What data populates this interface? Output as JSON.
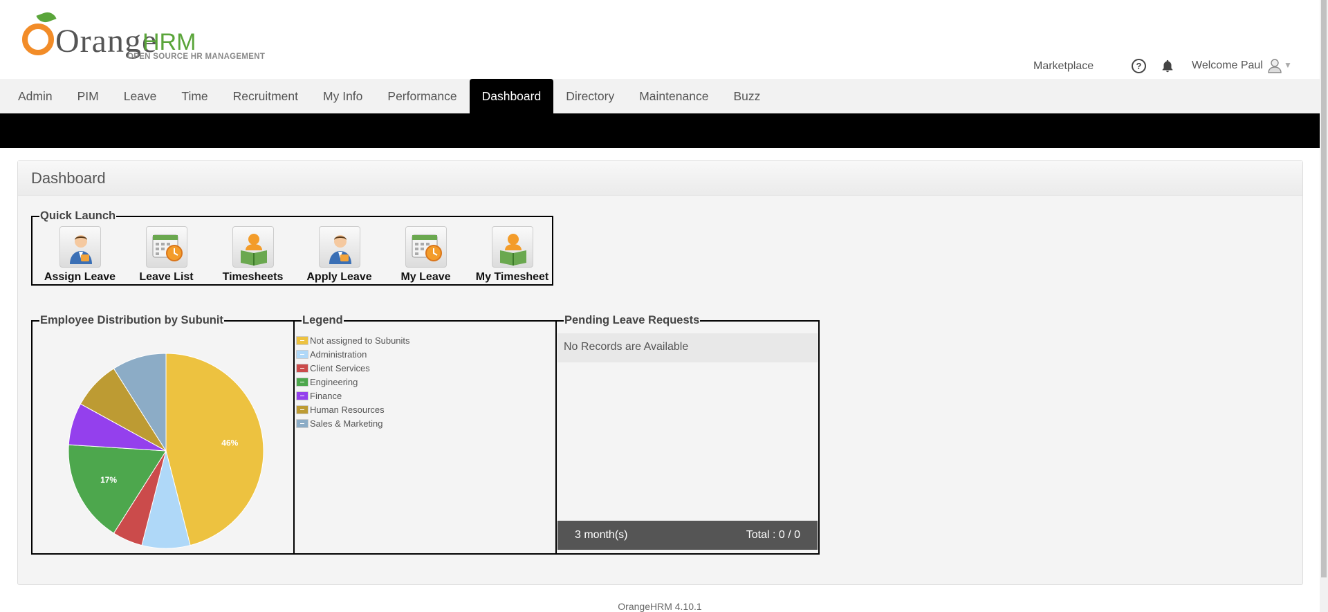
{
  "header": {
    "logo_text_a": "Orange",
    "logo_text_b": "HRM",
    "logo_tagline": "OPEN SOURCE HR MANAGEMENT",
    "marketplace": "Marketplace",
    "help_glyph": "?",
    "welcome": "Welcome Paul",
    "caret": "▼"
  },
  "nav": {
    "items": [
      "Admin",
      "PIM",
      "Leave",
      "Time",
      "Recruitment",
      "My Info",
      "Performance",
      "Dashboard",
      "Directory",
      "Maintenance",
      "Buzz"
    ],
    "active": "Dashboard"
  },
  "dashboard": {
    "title": "Dashboard",
    "quick_launch": {
      "title": "Quick Launch",
      "items": [
        {
          "label": "Assign Leave",
          "icon": "person-leave-icon"
        },
        {
          "label": "Leave List",
          "icon": "calendar-clock-icon"
        },
        {
          "label": "Timesheets",
          "icon": "person-book-icon"
        },
        {
          "label": "Apply Leave",
          "icon": "person-leave-icon"
        },
        {
          "label": "My Leave",
          "icon": "calendar-clock-icon"
        },
        {
          "label": "My Timesheet",
          "icon": "person-book-icon"
        }
      ]
    },
    "distribution": {
      "title": "Employee Distribution by Subunit"
    },
    "legend": {
      "title": "Legend",
      "items": [
        {
          "label": "Not assigned to Subunits",
          "color": "#edc240"
        },
        {
          "label": "Administration",
          "color": "#afd8f8"
        },
        {
          "label": "Client Services",
          "color": "#cb4b4b"
        },
        {
          "label": "Engineering",
          "color": "#4da74d"
        },
        {
          "label": "Finance",
          "color": "#9440ed"
        },
        {
          "label": "Human Resources",
          "color": "#bd9b33"
        },
        {
          "label": "Sales & Marketing",
          "color": "#8cacc6"
        }
      ]
    },
    "pending": {
      "title": "Pending Leave Requests",
      "empty_message": "No Records are Available",
      "period": "3 month(s)",
      "total": "Total : 0 / 0"
    }
  },
  "chart_data": {
    "type": "pie",
    "categories": [
      "Not assigned to Subunits",
      "Administration",
      "Client Services",
      "Engineering",
      "Finance",
      "Human Resources",
      "Sales & Marketing"
    ],
    "values": [
      46,
      8,
      5,
      17,
      7,
      8,
      9
    ],
    "colors": [
      "#edc240",
      "#afd8f8",
      "#cb4b4b",
      "#4da74d",
      "#9440ed",
      "#bd9b33",
      "#8cacc6"
    ],
    "data_labels": {
      "Not assigned to Subunits": "46%",
      "Engineering": "17%"
    },
    "legend_placement": "separate-panel-right"
  },
  "footer": {
    "version": "OrangeHRM 4.10.1"
  }
}
